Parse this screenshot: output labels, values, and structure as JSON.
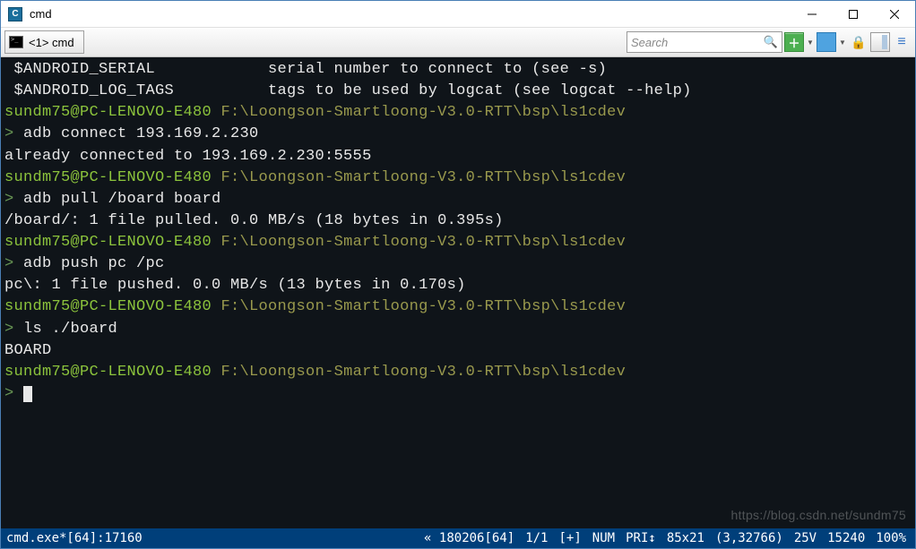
{
  "titlebar": {
    "title": "cmd"
  },
  "tab": {
    "label": "<1> cmd"
  },
  "search": {
    "placeholder": "Search"
  },
  "terminal": {
    "lines": [
      {
        "parts": [
          {
            "cls": "w",
            "text": " $ANDROID_SERIAL            serial number to connect to (see -s)"
          }
        ]
      },
      {
        "parts": [
          {
            "cls": "w",
            "text": " $ANDROID_LOG_TAGS          tags to be used by logcat (see logcat --help)"
          }
        ]
      },
      {
        "parts": [
          {
            "cls": "",
            "text": ""
          }
        ]
      },
      {
        "parts": [
          {
            "cls": "g",
            "text": "sundm75@PC-LENOVO-E480 "
          },
          {
            "cls": "gy",
            "text": "F:\\Loongson-Smartloong-V3.0-RTT\\bsp\\ls1cdev"
          }
        ]
      },
      {
        "parts": [
          {
            "cls": "prompt-sym",
            "text": "> "
          },
          {
            "cls": "w",
            "text": "adb connect 193.169.2.230"
          }
        ]
      },
      {
        "parts": [
          {
            "cls": "w",
            "text": "already connected to 193.169.2.230:5555"
          }
        ]
      },
      {
        "parts": [
          {
            "cls": "",
            "text": ""
          }
        ]
      },
      {
        "parts": [
          {
            "cls": "g",
            "text": "sundm75@PC-LENOVO-E480 "
          },
          {
            "cls": "gy",
            "text": "F:\\Loongson-Smartloong-V3.0-RTT\\bsp\\ls1cdev"
          }
        ]
      },
      {
        "parts": [
          {
            "cls": "prompt-sym",
            "text": "> "
          },
          {
            "cls": "w",
            "text": "adb pull /board board"
          }
        ]
      },
      {
        "parts": [
          {
            "cls": "w",
            "text": "/board/: 1 file pulled. 0.0 MB/s (18 bytes in 0.395s)"
          }
        ]
      },
      {
        "parts": [
          {
            "cls": "",
            "text": ""
          }
        ]
      },
      {
        "parts": [
          {
            "cls": "g",
            "text": "sundm75@PC-LENOVO-E480 "
          },
          {
            "cls": "gy",
            "text": "F:\\Loongson-Smartloong-V3.0-RTT\\bsp\\ls1cdev"
          }
        ]
      },
      {
        "parts": [
          {
            "cls": "prompt-sym",
            "text": "> "
          },
          {
            "cls": "w",
            "text": "adb push pc /pc"
          }
        ]
      },
      {
        "parts": [
          {
            "cls": "w",
            "text": "pc\\: 1 file pushed. 0.0 MB/s (13 bytes in 0.170s)"
          }
        ]
      },
      {
        "parts": [
          {
            "cls": "",
            "text": ""
          }
        ]
      },
      {
        "parts": [
          {
            "cls": "g",
            "text": "sundm75@PC-LENOVO-E480 "
          },
          {
            "cls": "gy",
            "text": "F:\\Loongson-Smartloong-V3.0-RTT\\bsp\\ls1cdev"
          }
        ]
      },
      {
        "parts": [
          {
            "cls": "prompt-sym",
            "text": "> "
          },
          {
            "cls": "w",
            "text": "ls ./board"
          }
        ]
      },
      {
        "parts": [
          {
            "cls": "w",
            "text": "BOARD"
          }
        ]
      },
      {
        "parts": [
          {
            "cls": "",
            "text": ""
          }
        ]
      },
      {
        "parts": [
          {
            "cls": "g",
            "text": "sundm75@PC-LENOVO-E480 "
          },
          {
            "cls": "gy",
            "text": "F:\\Loongson-Smartloong-V3.0-RTT\\bsp\\ls1cdev"
          }
        ]
      }
    ]
  },
  "status": {
    "proc": "cmd.exe*[64]:17160",
    "seg1": "« 180206[64]",
    "seg2": "1/1",
    "seg3": "[+]",
    "seg4": "NUM",
    "seg5": "PRI↕",
    "seg6": "85x21",
    "seg7": "(3,32766)",
    "seg8": "25V",
    "seg9": "15240",
    "seg10": "100%"
  },
  "watermark": "https://blog.csdn.net/sundm75"
}
